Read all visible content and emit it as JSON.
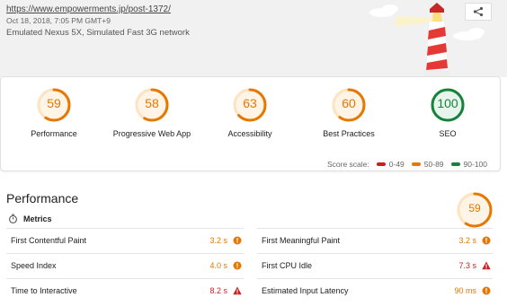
{
  "header": {
    "url": "https://www.empowerments.jp/post-1372/",
    "date": "Oct 18, 2018, 7:05 PM GMT+9",
    "device": "Emulated Nexus 5X, Simulated Fast 3G network"
  },
  "icons": {
    "share": "share-icon",
    "metrics": "stopwatch-icon",
    "average": "orange-circle-icon",
    "fail": "red-triangle-icon"
  },
  "colors": {
    "fail": "#c7221f",
    "average": "#e67700",
    "pass": "#178239"
  },
  "gauges": [
    {
      "score": "59",
      "label": "Performance",
      "level": 0.59,
      "status": "average"
    },
    {
      "score": "58",
      "label": "Progressive Web App",
      "level": 0.58,
      "status": "average"
    },
    {
      "score": "63",
      "label": "Accessibility",
      "level": 0.63,
      "status": "average"
    },
    {
      "score": "60",
      "label": "Best Practices",
      "level": 0.6,
      "status": "average"
    },
    {
      "score": "100",
      "label": "SEO",
      "level": 1.0,
      "status": "pass"
    }
  ],
  "scale": {
    "label": "Score scale:",
    "fail": "0-49",
    "average": "50-89",
    "pass": "90-100"
  },
  "performance": {
    "title": "Performance",
    "score": "59",
    "level": 0.59,
    "metrics_label": "Metrics",
    "metrics": [
      {
        "label": "First Contentful Paint",
        "value": "3.2 s",
        "status": "average"
      },
      {
        "label": "First Meaningful Paint",
        "value": "3.2 s",
        "status": "average"
      },
      {
        "label": "Speed Index",
        "value": "4.0 s",
        "status": "average"
      },
      {
        "label": "First CPU Idle",
        "value": "7.3 s",
        "status": "fail"
      },
      {
        "label": "Time to Interactive",
        "value": "8.2 s",
        "status": "fail"
      },
      {
        "label": "Estimated Input Latency",
        "value": "90 ms",
        "status": "average"
      }
    ]
  }
}
